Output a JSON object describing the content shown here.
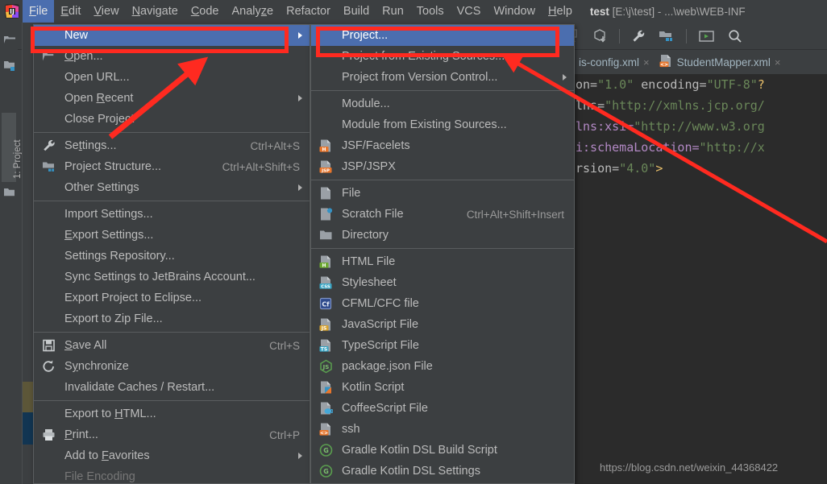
{
  "window": {
    "app_icon": "intellij-logo-icon",
    "title_project": "test",
    "title_rest": " [E:\\j\\test] - ...\\web\\WEB-INF"
  },
  "menubar": {
    "items": [
      {
        "label": "File",
        "mnemonic": "F",
        "active": true
      },
      {
        "label": "Edit",
        "mnemonic": "E",
        "active": false
      },
      {
        "label": "View",
        "mnemonic": "V",
        "active": false
      },
      {
        "label": "Navigate",
        "mnemonic": "N",
        "active": false
      },
      {
        "label": "Code",
        "mnemonic": "C",
        "active": false
      },
      {
        "label": "Analyze",
        "mnemonic": "z",
        "active": false
      },
      {
        "label": "Refactor",
        "mnemonic": "",
        "active": false
      },
      {
        "label": "Build",
        "mnemonic": "",
        "active": false
      },
      {
        "label": "Run",
        "mnemonic": "",
        "active": false
      },
      {
        "label": "Tools",
        "mnemonic": "",
        "active": false
      },
      {
        "label": "VCS",
        "mnemonic": "",
        "active": false
      },
      {
        "label": "Window",
        "mnemonic": "",
        "active": false
      },
      {
        "label": "Help",
        "mnemonic": "H",
        "active": false
      }
    ]
  },
  "toolbar": {
    "icons": [
      "build-icon",
      "download-icon",
      "settings-wrench-icon",
      "project-structure-icon",
      "run-icon",
      "search-icon"
    ]
  },
  "sidebar": {
    "project_tab_label": "1: Project",
    "icons": [
      "folder-open-icon",
      "folder-module-icon",
      "folder-icon"
    ]
  },
  "file_menu": {
    "name": "File",
    "items": [
      {
        "label": "New",
        "mnemonic": "",
        "icon": "",
        "shortcut": "",
        "submenu": true,
        "selected": true,
        "disabled": false
      },
      {
        "label": "Open...",
        "mnemonic": "O",
        "icon": "folder-open-icon",
        "shortcut": "",
        "submenu": false,
        "selected": false,
        "disabled": false
      },
      {
        "label": "Open URL...",
        "mnemonic": "",
        "icon": "",
        "shortcut": "",
        "submenu": false,
        "selected": false,
        "disabled": false
      },
      {
        "label": "Open Recent",
        "mnemonic": "R",
        "icon": "",
        "shortcut": "",
        "submenu": true,
        "selected": false,
        "disabled": false
      },
      {
        "label": "Close Project",
        "mnemonic": "",
        "icon": "",
        "shortcut": "",
        "submenu": false,
        "selected": false,
        "disabled": false
      },
      {
        "separator": true
      },
      {
        "label": "Settings...",
        "mnemonic": "t",
        "icon": "wrench-icon",
        "shortcut": "Ctrl+Alt+S",
        "submenu": false,
        "selected": false,
        "disabled": false
      },
      {
        "label": "Project Structure...",
        "mnemonic": "",
        "icon": "project-structure-icon",
        "shortcut": "Ctrl+Alt+Shift+S",
        "submenu": false,
        "selected": false,
        "disabled": false
      },
      {
        "label": "Other Settings",
        "mnemonic": "",
        "icon": "",
        "shortcut": "",
        "submenu": true,
        "selected": false,
        "disabled": false
      },
      {
        "separator": true
      },
      {
        "label": "Import Settings...",
        "mnemonic": "",
        "icon": "",
        "shortcut": "",
        "submenu": false,
        "selected": false,
        "disabled": false
      },
      {
        "label": "Export Settings...",
        "mnemonic": "E",
        "icon": "",
        "shortcut": "",
        "submenu": false,
        "selected": false,
        "disabled": false
      },
      {
        "label": "Settings Repository...",
        "mnemonic": "",
        "icon": "",
        "shortcut": "",
        "submenu": false,
        "selected": false,
        "disabled": false
      },
      {
        "label": "Sync Settings to JetBrains Account...",
        "mnemonic": "",
        "icon": "",
        "shortcut": "",
        "submenu": false,
        "selected": false,
        "disabled": false
      },
      {
        "label": "Export Project to Eclipse...",
        "mnemonic": "",
        "icon": "",
        "shortcut": "",
        "submenu": false,
        "selected": false,
        "disabled": false
      },
      {
        "label": "Export to Zip File...",
        "mnemonic": "",
        "icon": "",
        "shortcut": "",
        "submenu": false,
        "selected": false,
        "disabled": false
      },
      {
        "separator": true
      },
      {
        "label": "Save All",
        "mnemonic": "S",
        "icon": "save-icon",
        "shortcut": "Ctrl+S",
        "submenu": false,
        "selected": false,
        "disabled": false
      },
      {
        "label": "Synchronize",
        "mnemonic": "y",
        "icon": "sync-icon",
        "shortcut": "",
        "submenu": false,
        "selected": false,
        "disabled": false
      },
      {
        "label": "Invalidate Caches / Restart...",
        "mnemonic": "",
        "icon": "",
        "shortcut": "",
        "submenu": false,
        "selected": false,
        "disabled": false
      },
      {
        "separator": true
      },
      {
        "label": "Export to HTML...",
        "mnemonic": "H",
        "icon": "",
        "shortcut": "",
        "submenu": false,
        "selected": false,
        "disabled": false
      },
      {
        "label": "Print...",
        "mnemonic": "P",
        "icon": "print-icon",
        "shortcut": "Ctrl+P",
        "submenu": false,
        "selected": false,
        "disabled": false
      },
      {
        "label": "Add to Favorites",
        "mnemonic": "F",
        "icon": "",
        "shortcut": "",
        "submenu": true,
        "selected": false,
        "disabled": false
      },
      {
        "label": "File Encoding",
        "mnemonic": "",
        "icon": "",
        "shortcut": "",
        "submenu": false,
        "selected": false,
        "disabled": true
      }
    ]
  },
  "new_submenu": {
    "name": "New",
    "items": [
      {
        "label": "Project...",
        "icon": "",
        "shortcut": "",
        "submenu": false,
        "selected": true
      },
      {
        "label": "Project from Existing Sources...",
        "icon": "",
        "shortcut": "",
        "submenu": false,
        "selected": false
      },
      {
        "label": "Project from Version Control...",
        "icon": "",
        "shortcut": "",
        "submenu": true,
        "selected": false
      },
      {
        "separator": true
      },
      {
        "label": "Module...",
        "icon": "",
        "shortcut": "",
        "submenu": false,
        "selected": false
      },
      {
        "label": "Module from Existing Sources...",
        "icon": "",
        "shortcut": "",
        "submenu": false,
        "selected": false
      },
      {
        "label": "JSF/Facelets",
        "icon": "jsf-file-icon",
        "badge": "H",
        "badge_color": "#e8762c",
        "shortcut": "",
        "submenu": false,
        "selected": false
      },
      {
        "label": "JSP/JSPX",
        "icon": "jsp-file-icon",
        "badge": "JSP",
        "badge_color": "#e8762c",
        "shortcut": "",
        "submenu": false,
        "selected": false
      },
      {
        "separator": true
      },
      {
        "label": "File",
        "icon": "file-icon",
        "badge": "",
        "shortcut": "",
        "submenu": false,
        "selected": false
      },
      {
        "label": "Scratch File",
        "icon": "scratch-file-icon",
        "badge": "",
        "shortcut": "Ctrl+Alt+Shift+Insert",
        "submenu": false,
        "selected": false
      },
      {
        "label": "Directory",
        "icon": "directory-icon",
        "badge": "",
        "shortcut": "",
        "submenu": false,
        "selected": false
      },
      {
        "separator": true
      },
      {
        "label": "HTML File",
        "icon": "html-file-icon",
        "badge": "H",
        "badge_color": "#6ca930",
        "shortcut": "",
        "submenu": false,
        "selected": false
      },
      {
        "label": "Stylesheet",
        "icon": "css-file-icon",
        "badge": "CSS",
        "badge_color": "#39a5c4",
        "shortcut": "",
        "submenu": false,
        "selected": false
      },
      {
        "label": "CFML/CFC file",
        "icon": "cfml-file-icon",
        "badge": "Cf",
        "badge_color": "#2f4b8c",
        "shortcut": "",
        "submenu": false,
        "selected": false
      },
      {
        "label": "JavaScript File",
        "icon": "javascript-file-icon",
        "badge": "JS",
        "badge_color": "#d8a32e",
        "shortcut": "",
        "submenu": false,
        "selected": false
      },
      {
        "label": "TypeScript File",
        "icon": "typescript-file-icon",
        "badge": "TS",
        "badge_color": "#39a5c4",
        "shortcut": "",
        "submenu": false,
        "selected": false
      },
      {
        "label": "package.json File",
        "icon": "nodejs-package-icon",
        "badge": "JS",
        "badge_color": "#5a9e4f",
        "shortcut": "",
        "submenu": false,
        "selected": false
      },
      {
        "label": "Kotlin Script",
        "icon": "kotlin-script-icon",
        "badge": "",
        "shortcut": "",
        "submenu": false,
        "selected": false
      },
      {
        "label": "CoffeeScript File",
        "icon": "coffeescript-file-icon",
        "badge": "",
        "shortcut": "",
        "submenu": false,
        "selected": false
      },
      {
        "label": "ssh",
        "icon": "ssh-file-icon",
        "badge": "<>",
        "badge_color": "#e8762c",
        "shortcut": "",
        "submenu": false,
        "selected": false
      },
      {
        "label": "Gradle Kotlin DSL Build Script",
        "icon": "gradle-icon",
        "badge": "G",
        "badge_color": "#5a9e4f",
        "shortcut": "",
        "submenu": false,
        "selected": false
      },
      {
        "label": "Gradle Kotlin DSL Settings",
        "icon": "gradle-icon",
        "badge": "G",
        "badge_color": "#5a9e4f",
        "shortcut": "",
        "submenu": false,
        "selected": false
      }
    ]
  },
  "editor": {
    "tabs": [
      {
        "label": "is-config.xml",
        "icon": "",
        "close": "×"
      },
      {
        "label": "StudentMapper.xml",
        "icon": "xml-file-icon",
        "close": "×"
      }
    ],
    "code_lines": [
      "on=\"1.0\" encoding=\"UTF-8\"?",
      "lns=\"http://xmlns.jcp.org/",
      "lns:xsi=\"http://www.w3.org",
      "i:schemaLocation=\"http://x",
      "rsion=\"4.0\">"
    ]
  },
  "watermark": "https://blog.csdn.net/weixin_44368422",
  "annotations": {
    "highlight_color": "#ff2a20",
    "boxes": [
      "new-menu-item-box",
      "project-submenu-item-box"
    ],
    "arrows": [
      "arrow-to-new",
      "arrow-to-project"
    ]
  },
  "colors": {
    "selection": "#4b6eaf",
    "menu_bg": "#3c3f41",
    "editor_bg": "#2b2b2b",
    "accent_red": "#ff2a20"
  }
}
